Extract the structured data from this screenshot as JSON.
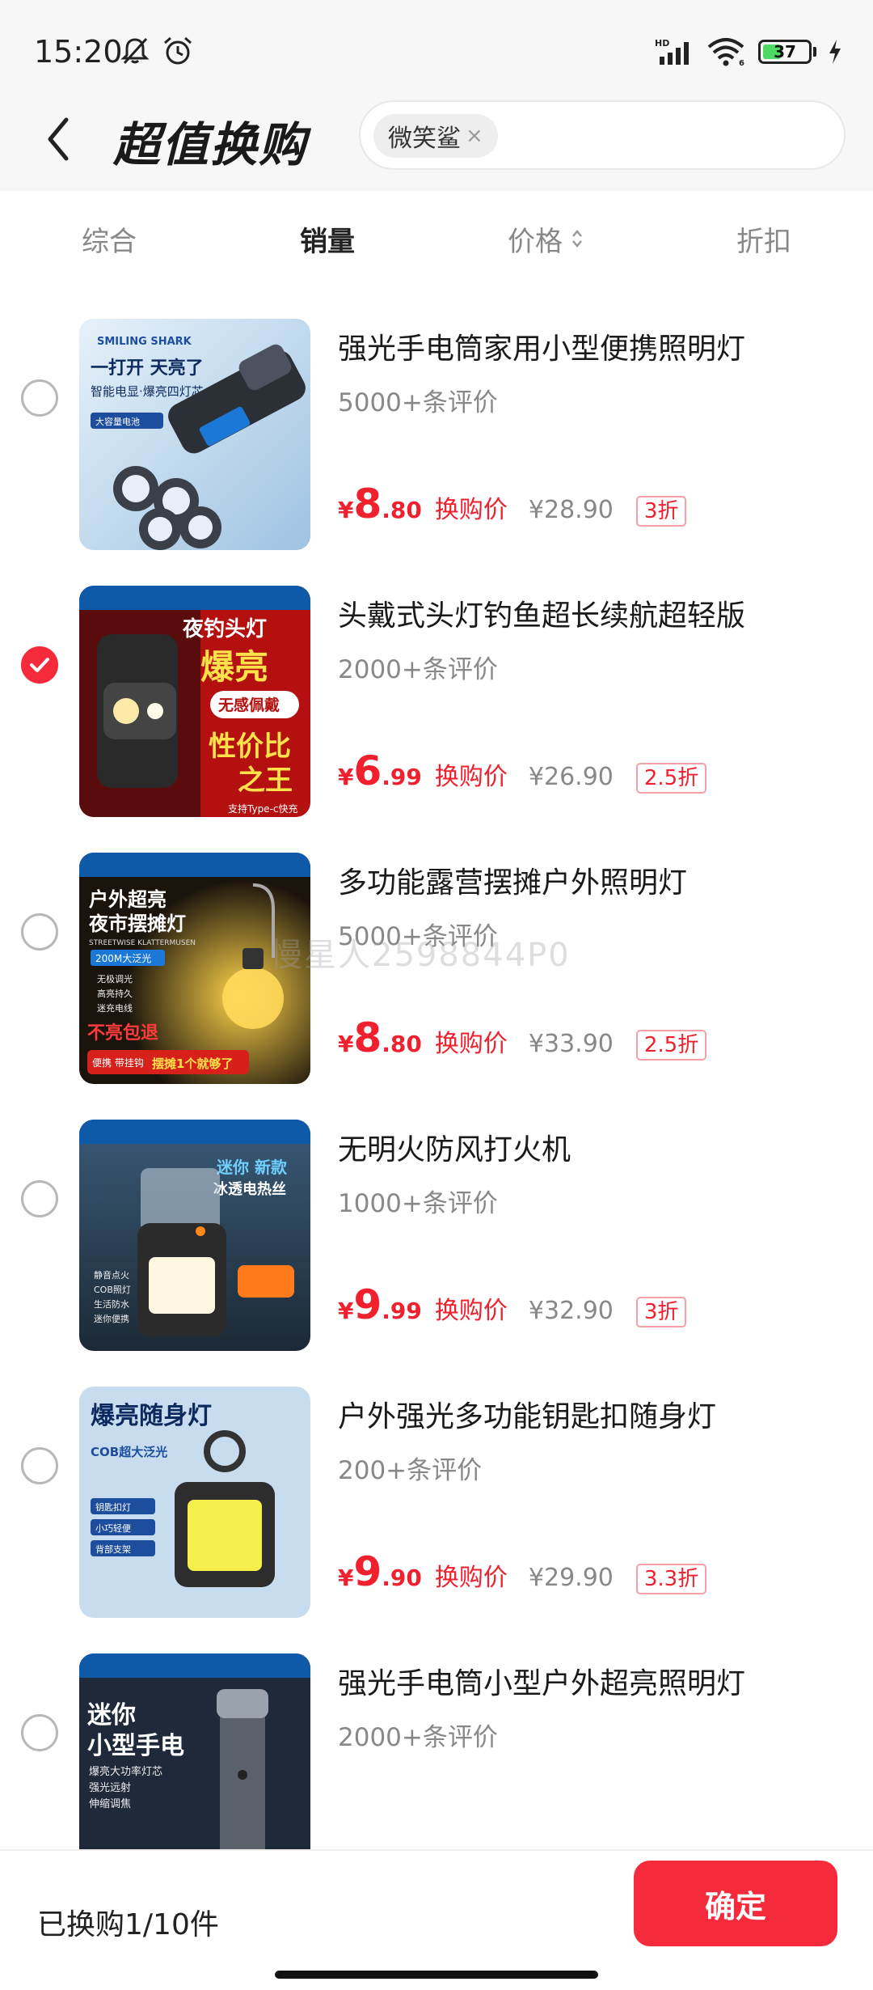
{
  "status": {
    "time": "15:20",
    "network": "HD",
    "network_sub": "6",
    "battery": "37"
  },
  "header": {
    "title": "超值换购",
    "search_chip": "微笑鲨"
  },
  "sort_tabs": [
    {
      "label": "综合"
    },
    {
      "label": "销量"
    },
    {
      "label": "价格"
    },
    {
      "label": "折扣"
    }
  ],
  "products": [
    {
      "title": "强光手电筒家用小型便携照明灯",
      "reviews": "5000+条评价",
      "currency": "¥",
      "price_int": "8",
      "price_dec": ".80",
      "price_label": "换购价",
      "original_price": "¥28.90",
      "discount": "3折",
      "selected": false,
      "image_text": [
        "SMILING SHARK",
        "一打开 天亮了",
        "智能电显·爆亮四灯芯",
        "大容量电池"
      ]
    },
    {
      "title": "头戴式头灯钓鱼超长续航超轻版",
      "reviews": "2000+条评价",
      "currency": "¥",
      "price_int": "6",
      "price_dec": ".99",
      "price_label": "换购价",
      "original_price": "¥26.90",
      "discount": "2.5折",
      "selected": true,
      "image_text": [
        "夜钓头灯",
        "爆亮",
        "无感佩戴",
        "性价比",
        "之王",
        "支持Type-c快充"
      ]
    },
    {
      "title": "多功能露营摆摊户外照明灯",
      "reviews": "5000+条评价",
      "currency": "¥",
      "price_int": "8",
      "price_dec": ".80",
      "price_label": "换购价",
      "original_price": "¥33.90",
      "discount": "2.5折",
      "selected": false,
      "image_text": [
        "户外超亮",
        "夜市摆摊灯",
        "STREETWISE KLATTERMUSEN",
        "200M大泛光",
        "无极调光",
        "高亮持久",
        "迷充电线",
        "不亮包退",
        "便携 带挂钩",
        "摆摊1个就够了"
      ]
    },
    {
      "title": "无明火防风打火机",
      "reviews": "1000+条评价",
      "currency": "¥",
      "price_int": "9",
      "price_dec": ".99",
      "price_label": "换购价",
      "original_price": "¥32.90",
      "discount": "3折",
      "selected": false,
      "image_text": [
        "迷你 新款",
        "冰透电热丝",
        "静音点火",
        "COB照灯",
        "生活防水",
        "迷你便携"
      ]
    },
    {
      "title": "户外强光多功能钥匙扣随身灯",
      "reviews": "200+条评价",
      "currency": "¥",
      "price_int": "9",
      "price_dec": ".90",
      "price_label": "换购价",
      "original_price": "¥29.90",
      "discount": "3.3折",
      "selected": false,
      "image_text": [
        "爆亮随身灯",
        "COB超大泛光",
        "钥匙扣灯",
        "小巧轻便",
        "背部支架"
      ]
    },
    {
      "title": "强光手电筒小型户外超亮照明灯",
      "reviews": "2000+条评价",
      "currency": "",
      "price_int": "",
      "price_dec": "",
      "price_label": "",
      "original_price": "",
      "discount": "",
      "selected": false,
      "image_text": [
        "迷你",
        "小型手电",
        "爆亮大功率灯芯",
        "强光远射",
        "伸缩调焦"
      ]
    }
  ],
  "watermark": "慢星人2598844P0",
  "footer": {
    "count_text": "已换购1/10件",
    "confirm_label": "确定"
  },
  "colors": {
    "accent": "#f52a3a",
    "price_red": "#f0202e"
  }
}
